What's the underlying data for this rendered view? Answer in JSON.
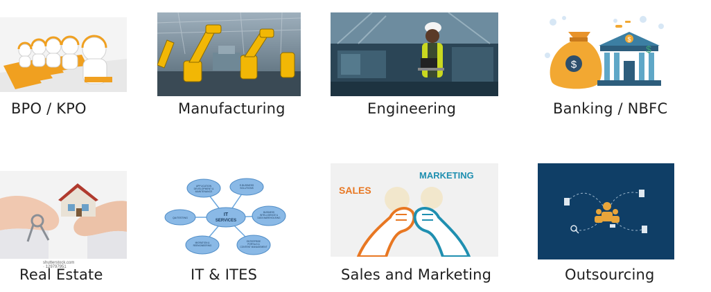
{
  "tiles": [
    {
      "label": "BPO / KPO",
      "image": "call-center-agents-illustration"
    },
    {
      "label": "Manufacturing",
      "image": "robotic-arms-factory-photo"
    },
    {
      "label": "Engineering",
      "image": "engineer-with-laptop-photo"
    },
    {
      "label": "Banking / NBFC",
      "image": "money-bag-and-bank-illustration"
    },
    {
      "label": "Real Estate",
      "image": "hands-holding-house-and-keys-photo"
    },
    {
      "label": "IT & ITES",
      "image": "it-services-bubble-diagram"
    },
    {
      "label": "Sales and Marketing",
      "image": "sales-marketing-fists-illustration"
    },
    {
      "label": "Outsourcing",
      "image": "outsourcing-network-illustration"
    }
  ],
  "it_diagram": {
    "center": "IT SERVICES",
    "nodes": [
      "APPLICATION DEVELOPMENT & MAINTENANCE",
      "E-BUSINESS SOLUTIONS",
      "BUSINESS INTELLIGENCE & DATA WAREHOUSING",
      "ENTERPRISE PORTALS & CONTENT MANAGEMENT",
      "MIGRATION & REENGINEERING",
      "QA/TESTING"
    ]
  },
  "sales_art": {
    "sales": "SALES",
    "marketing": "MARKETING"
  },
  "watermark": "shutterstock.com · 129797951",
  "colors": {
    "navy": "#0f3e66",
    "orange": "#e87722",
    "teal": "#1f8fb0",
    "bubble": "#6aa6dd"
  }
}
